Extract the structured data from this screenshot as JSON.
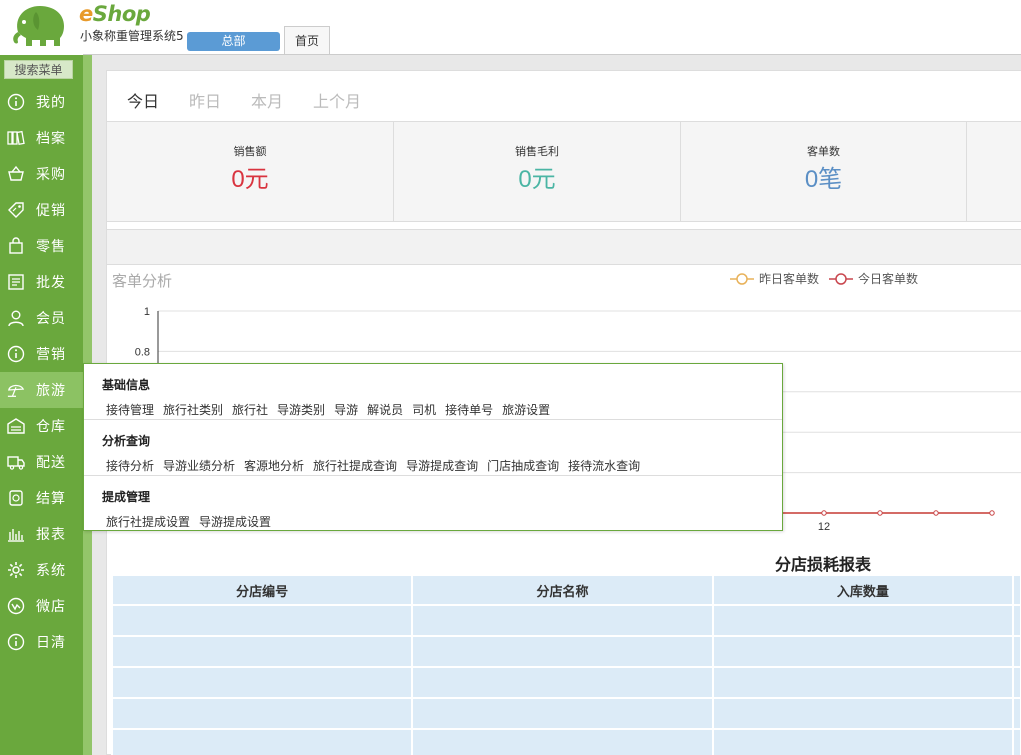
{
  "header": {
    "brand_e": "e",
    "brand_shop": "Shop",
    "system_name": "小象称重管理系统5",
    "branch_button": "总部",
    "home_tab": "首页"
  },
  "sidebar": {
    "search_label": "搜索菜单",
    "items": [
      {
        "label": "我的",
        "icon": "info-icon"
      },
      {
        "label": "档案",
        "icon": "files-icon"
      },
      {
        "label": "采购",
        "icon": "basket-icon"
      },
      {
        "label": "促销",
        "icon": "tag-icon"
      },
      {
        "label": "零售",
        "icon": "bag-icon"
      },
      {
        "label": "批发",
        "icon": "wholesale-icon"
      },
      {
        "label": "会员",
        "icon": "user-icon"
      },
      {
        "label": "营销",
        "icon": "info-icon"
      },
      {
        "label": "旅游",
        "icon": "umbrella-icon"
      },
      {
        "label": "仓库",
        "icon": "warehouse-icon"
      },
      {
        "label": "配送",
        "icon": "truck-icon"
      },
      {
        "label": "结算",
        "icon": "settle-icon"
      },
      {
        "label": "报表",
        "icon": "bar-chart-icon"
      },
      {
        "label": "系统",
        "icon": "gear-icon"
      },
      {
        "label": "微店",
        "icon": "shop-icon"
      },
      {
        "label": "日清",
        "icon": "info-icon"
      }
    ],
    "active_index": 8
  },
  "period_tabs": [
    "今日",
    "昨日",
    "本月",
    "上个月"
  ],
  "stats": [
    {
      "label": "销售额",
      "value": "0元",
      "color": "#d9343f"
    },
    {
      "label": "销售毛利",
      "value": "0元",
      "color": "#4ab5a4"
    },
    {
      "label": "客单数",
      "value": "0笔",
      "color": "#5b8fc5"
    }
  ],
  "chart": {
    "title": "客单分析",
    "legend_yesterday": "昨日客单数",
    "legend_today": "今日客单数",
    "yesterday_color": "#e8b25a",
    "today_color": "#c9474f"
  },
  "chart_data": {
    "type": "line",
    "title": "客单分析",
    "ylim": [
      0,
      1
    ],
    "y_ticks": [
      "1",
      "0.8"
    ],
    "x_ticks_visible": [
      "12"
    ],
    "series": [
      {
        "name": "昨日客单数",
        "values": [
          0,
          0,
          0,
          0,
          0,
          0,
          0,
          0,
          0,
          0,
          0,
          0,
          0,
          0,
          0,
          0,
          0,
          0,
          0,
          0,
          0,
          0,
          0,
          0
        ]
      },
      {
        "name": "今日客单数",
        "values": [
          0,
          0,
          0,
          0,
          0,
          0,
          0,
          0,
          0,
          0,
          0,
          0,
          0,
          0,
          0,
          0,
          0,
          0,
          0,
          0,
          0,
          0,
          0,
          0
        ]
      }
    ]
  },
  "report": {
    "title": "分店损耗报表",
    "columns": [
      "分店编号",
      "分店名称",
      "入库数量"
    ]
  },
  "popup": {
    "sections": [
      {
        "heading": "基础信息",
        "links": [
          "接待管理",
          "旅行社类别",
          "旅行社",
          "导游类别",
          "导游",
          "解说员",
          "司机",
          "接待单号",
          "旅游设置"
        ]
      },
      {
        "heading": "分析查询",
        "links": [
          "接待分析",
          "导游业绩分析",
          "客源地分析",
          "旅行社提成查询",
          "导游提成查询",
          "门店抽成查询",
          "接待流水查询"
        ]
      },
      {
        "heading": "提成管理",
        "links": [
          "旅行社提成设置",
          "导游提成设置"
        ]
      }
    ]
  }
}
